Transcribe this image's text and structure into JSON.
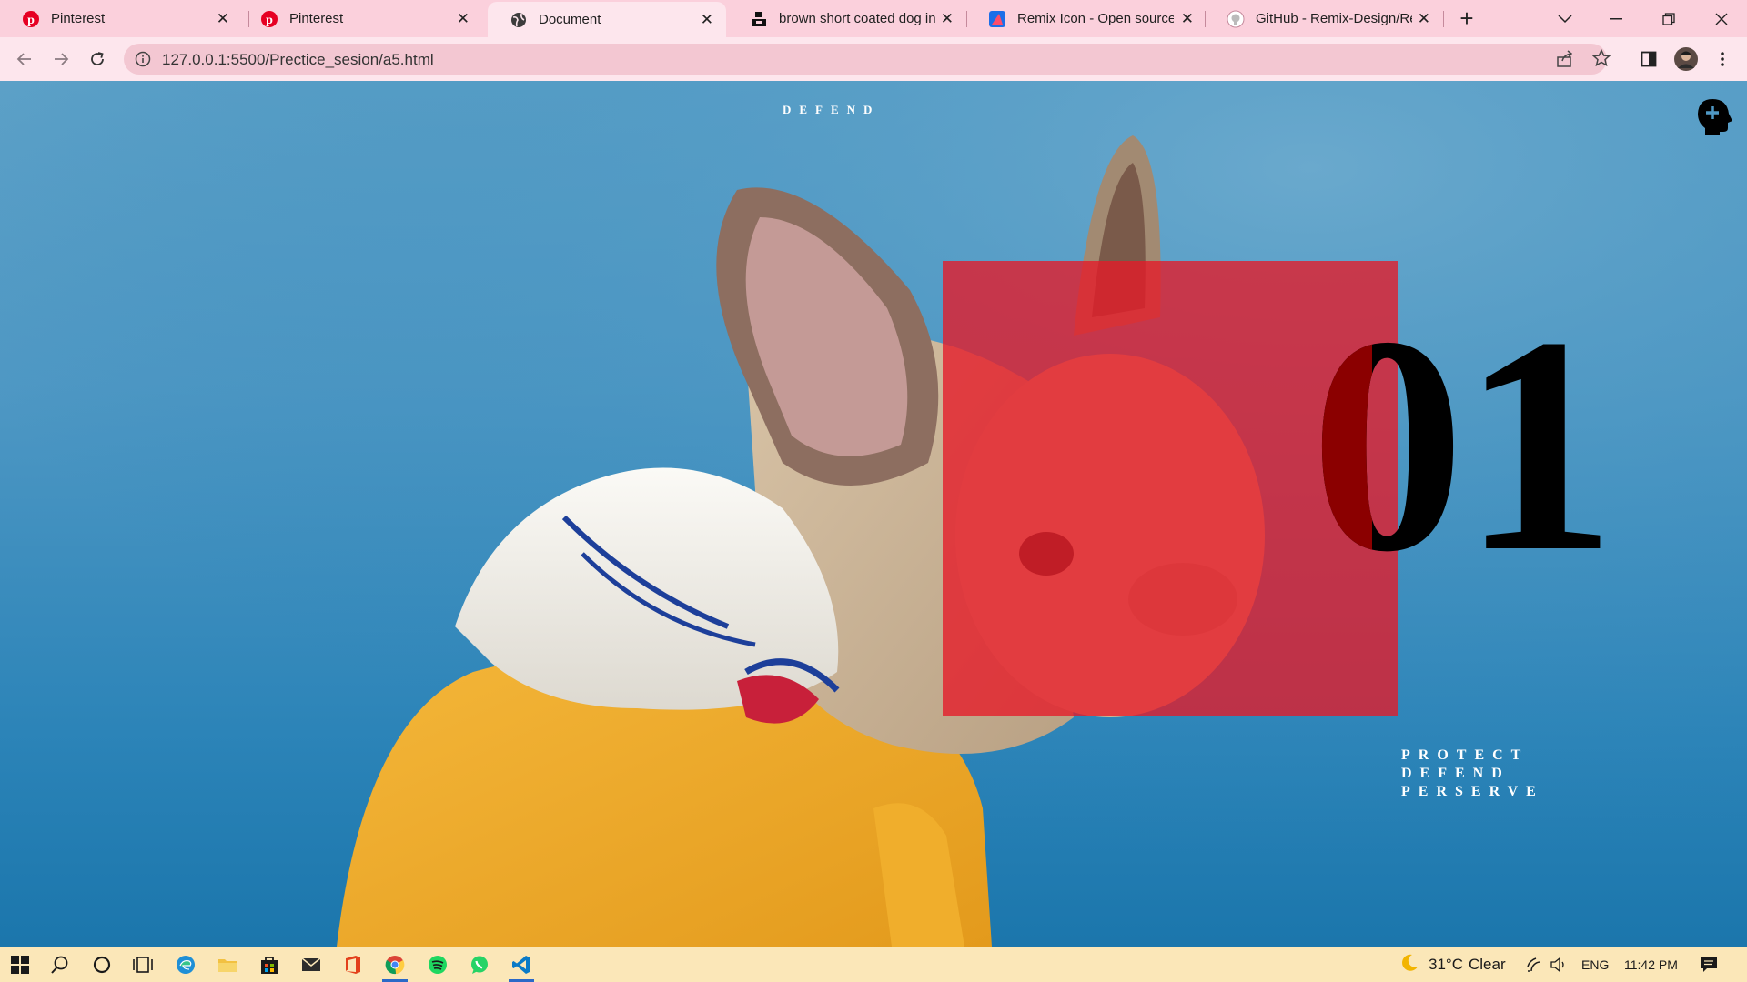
{
  "browser": {
    "tabs": [
      {
        "title": "Pinterest",
        "icon": "pinterest-icon",
        "active": false
      },
      {
        "title": "Pinterest",
        "icon": "pinterest-icon",
        "active": false
      },
      {
        "title": "Document",
        "icon": "globe-icon",
        "active": true
      },
      {
        "title": "brown short coated dog in",
        "icon": "unsplash-icon",
        "active": false
      },
      {
        "title": "Remix Icon - Open source i",
        "icon": "remix-icon",
        "active": false
      },
      {
        "title": "GitHub - Remix-Design/Re",
        "icon": "github-icon",
        "active": false
      }
    ],
    "url": "127.0.0.1:5500/Prectice_sesion/a5.html"
  },
  "page": {
    "brand": "DEFEND",
    "number": "01",
    "tagline": [
      "PROTECT",
      "DEFEND",
      "PERSERVE"
    ],
    "colors": {
      "overlay": "#e61928",
      "number": "#000000",
      "number_overlap": "#8b0000",
      "background": "#4f98c4"
    }
  },
  "taskbar": {
    "apps": [
      "windows-start-icon",
      "search-icon",
      "cortana-icon",
      "task-view-icon",
      "edge-icon",
      "file-explorer-icon",
      "store-icon",
      "mail-icon",
      "office-icon",
      "chrome-icon",
      "spotify-icon",
      "whatsapp-icon",
      "vscode-icon"
    ],
    "weather": "31°C",
    "weather_desc": "Clear",
    "language": "ENG",
    "time": "11:42 PM"
  }
}
